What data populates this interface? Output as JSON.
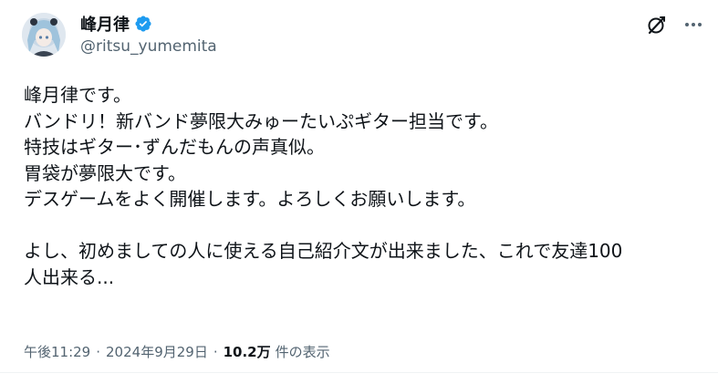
{
  "author": {
    "display_name": "峰月律",
    "handle": "@ritsu_yumemita",
    "verified_icon": "verified-badge-icon",
    "avatar_icon": "avatar"
  },
  "toolbar": {
    "grok_icon": "grok-icon",
    "more_icon": "more-icon"
  },
  "body": {
    "lines": [
      "峰月律です。",
      "バンドリ！新バンド夢限大みゅーたいぷギター担当です。",
      "特技はギター･ずんだもんの声真似。",
      "胃袋が夢限大です。",
      "デスゲームをよく開催します。よろしくお願いします。",
      "",
      "よし、初めましての人に使える自己紹介文が出来ました、これで友達100",
      "人出来る..."
    ]
  },
  "meta": {
    "time": "午後11:29",
    "separator": "·",
    "date": "2024年9月29日",
    "views_count": "10.2万",
    "views_label": "件の表示"
  },
  "colors": {
    "text": "#0f1419",
    "secondary": "#536471",
    "verified_blue": "#1d9bf0"
  }
}
